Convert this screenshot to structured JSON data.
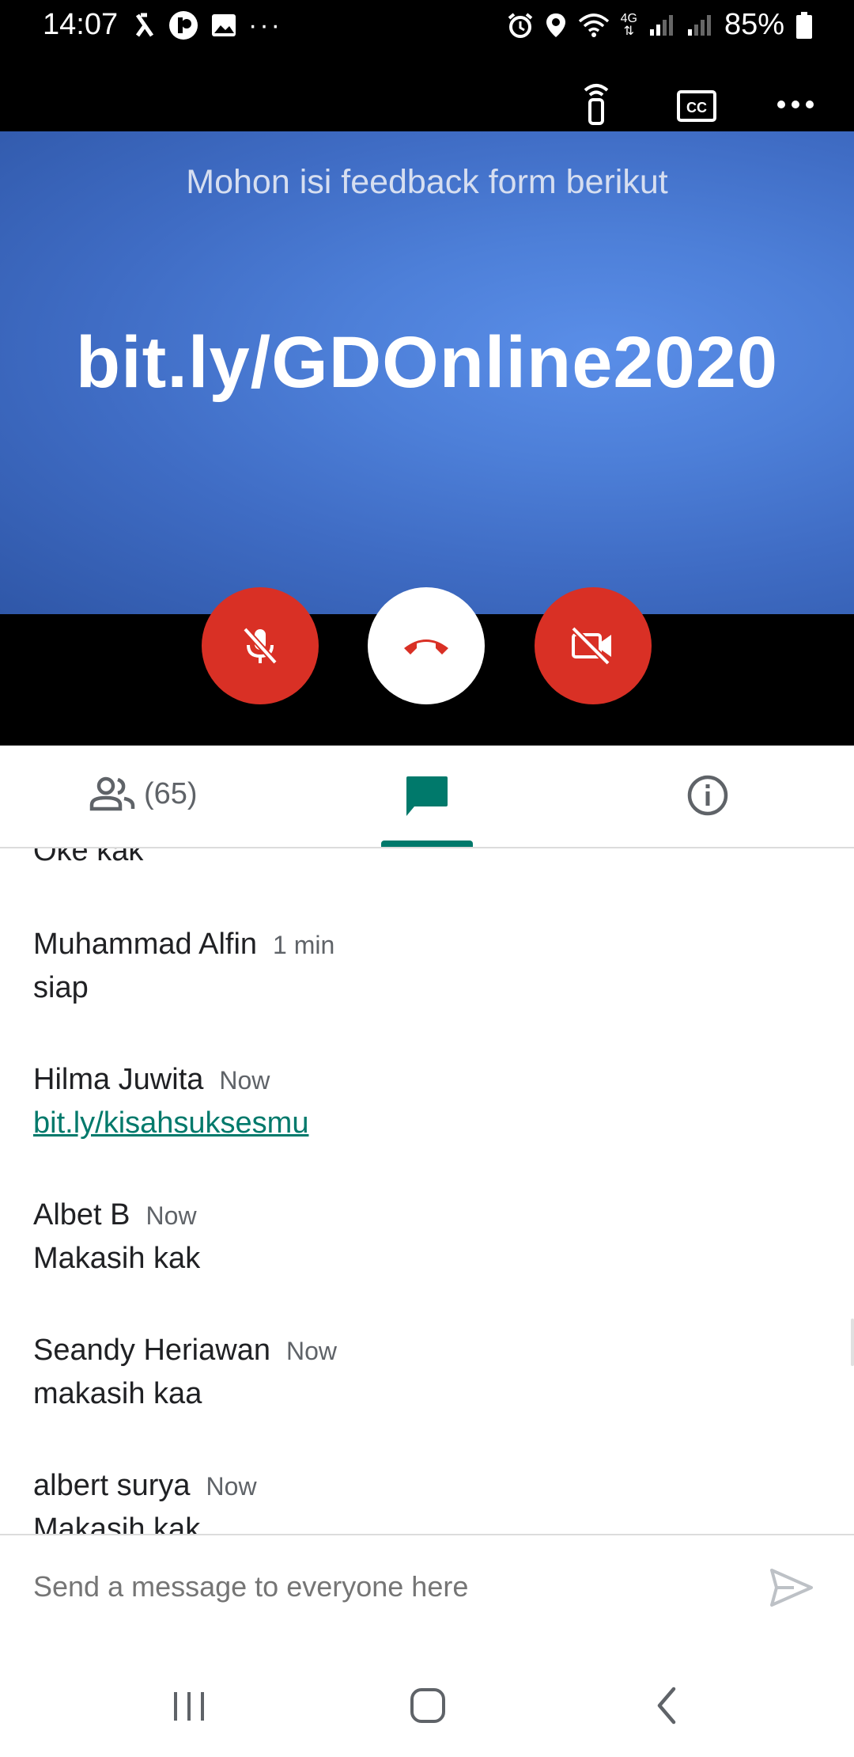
{
  "status_bar": {
    "time": "14:07",
    "network": "4G",
    "battery": "85%"
  },
  "slide": {
    "title": "Mohon isi feedback form berikut",
    "link": "bit.ly/GDOnline2020"
  },
  "tabs": {
    "people_count": "(65)"
  },
  "messages": [
    {
      "sender": "",
      "time": "",
      "text": "Oke kak"
    },
    {
      "sender": "Muhammad Alfin",
      "time": "1 min",
      "text": "siap"
    },
    {
      "sender": "Hilma Juwita",
      "time": "Now",
      "text": "bit.ly/kisahsuksesmu",
      "is_link": true
    },
    {
      "sender": "Albet B",
      "time": "Now",
      "text": "Makasih kak"
    },
    {
      "sender": "Seandy Heriawan",
      "time": "Now",
      "text": "makasih kaa"
    },
    {
      "sender": "albert surya",
      "time": "Now",
      "text": "Makasih kak"
    }
  ],
  "input": {
    "placeholder": "Send a message to everyone here"
  },
  "colors": {
    "accent": "#00796b",
    "danger": "#d93025",
    "slide_blue": "#4a7ad6"
  },
  "icons": [
    "remote-control-icon",
    "closed-captions-icon",
    "more-options-icon",
    "mic-off-icon",
    "hang-up-icon",
    "camera-off-icon",
    "people-icon",
    "chat-icon",
    "info-icon",
    "send-icon",
    "recent-apps-icon",
    "home-icon",
    "back-icon"
  ]
}
